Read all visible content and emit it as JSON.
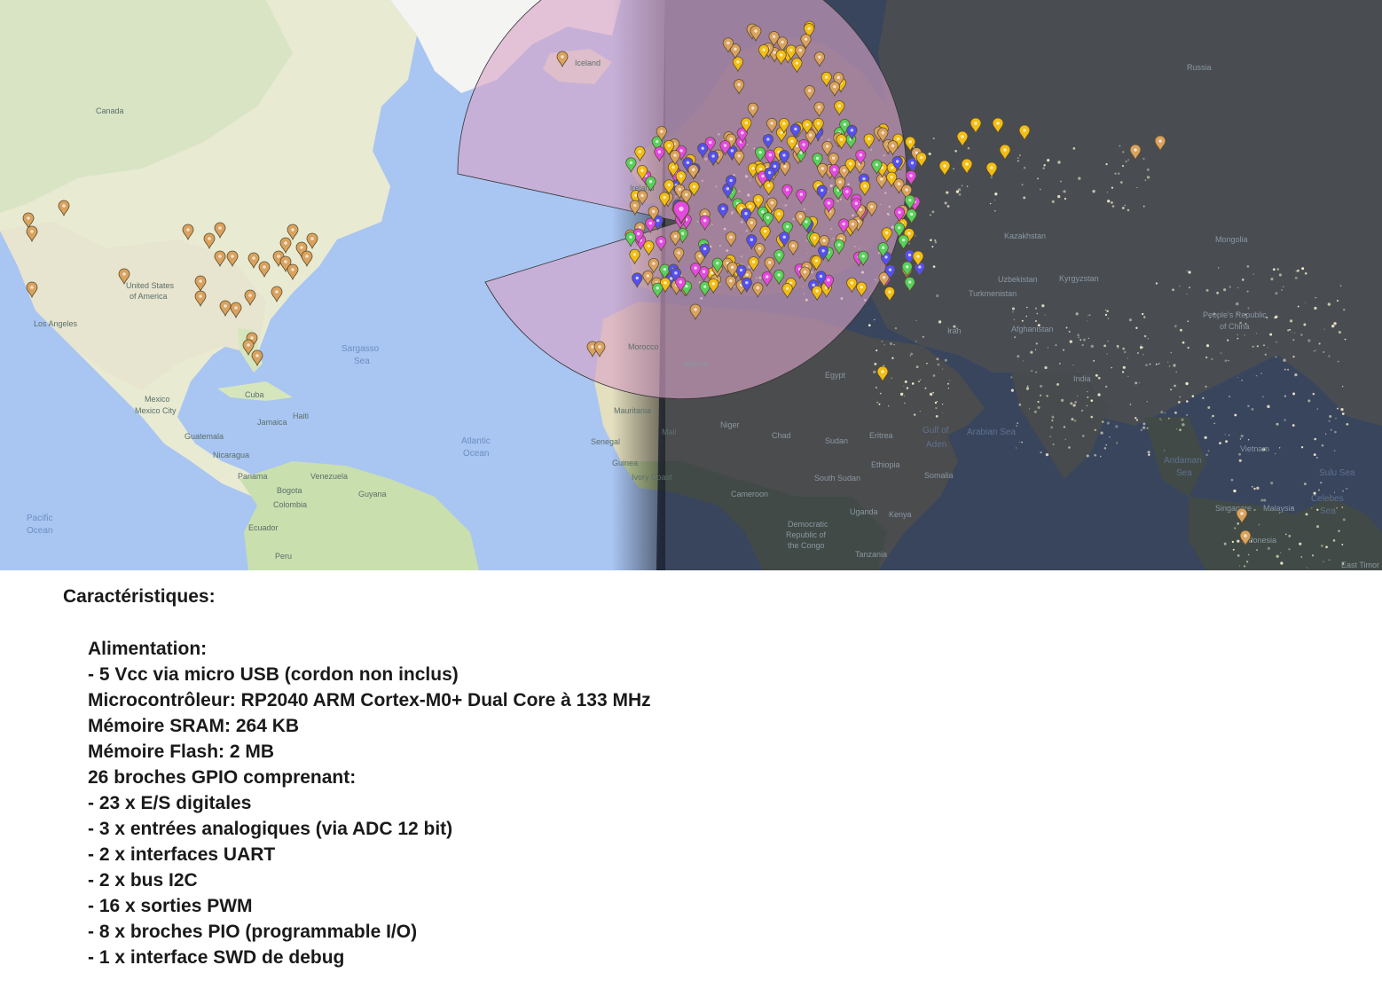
{
  "map": {
    "labels_light": [
      {
        "name": "canada",
        "text": "Canada"
      },
      {
        "name": "usa-1",
        "text": "United States"
      },
      {
        "name": "usa-2",
        "text": "of America"
      },
      {
        "name": "los-angeles",
        "text": "Los Angeles"
      },
      {
        "name": "mexico",
        "text": "Mexico"
      },
      {
        "name": "mexico-city",
        "text": "Mexico City"
      },
      {
        "name": "cuba",
        "text": "Cuba"
      },
      {
        "name": "haiti",
        "text": "Haiti"
      },
      {
        "name": "jamaica",
        "text": "Jamaica"
      },
      {
        "name": "guatemala",
        "text": "Guatemala"
      },
      {
        "name": "nicaragua",
        "text": "Nicaragua"
      },
      {
        "name": "panama",
        "text": "Panama"
      },
      {
        "name": "bogota",
        "text": "Bogota"
      },
      {
        "name": "colombia",
        "text": "Colombia"
      },
      {
        "name": "venezuela",
        "text": "Venezuela"
      },
      {
        "name": "guyana",
        "text": "Guyana"
      },
      {
        "name": "ecuador",
        "text": "Ecuador"
      },
      {
        "name": "peru",
        "text": "Peru"
      },
      {
        "name": "iceland",
        "text": "Iceland"
      },
      {
        "name": "ireland",
        "text": "Ireland"
      },
      {
        "name": "mauritania",
        "text": "Mauritania"
      },
      {
        "name": "senegal",
        "text": "Senegal"
      },
      {
        "name": "guinea",
        "text": "Guinea"
      },
      {
        "name": "ivory-coast",
        "text": "Ivory Coast"
      },
      {
        "name": "morocco",
        "text": "Morocco"
      },
      {
        "name": "mali",
        "text": "Mali"
      }
    ],
    "labels_ocean_light": [
      {
        "name": "sargasso-1",
        "text": "Sargasso"
      },
      {
        "name": "sargasso-2",
        "text": "Sea"
      },
      {
        "name": "atlantic-1",
        "text": "Atlantic"
      },
      {
        "name": "atlantic-2",
        "text": "Ocean"
      },
      {
        "name": "pacific-1",
        "text": "Pacific"
      },
      {
        "name": "pacific-2",
        "text": "Ocean"
      }
    ],
    "labels_dark": [
      {
        "name": "russia",
        "text": "Russia"
      },
      {
        "name": "kazakhstan",
        "text": "Kazakhstan"
      },
      {
        "name": "mongolia",
        "text": "Mongolia"
      },
      {
        "name": "uzbekistan",
        "text": "Uzbekistan"
      },
      {
        "name": "kyrgyzstan",
        "text": "Kyrgyzstan"
      },
      {
        "name": "turkmenistan",
        "text": "Turkmenistan"
      },
      {
        "name": "afghanistan",
        "text": "Afghanistan"
      },
      {
        "name": "iran",
        "text": "Iran"
      },
      {
        "name": "prc-1",
        "text": "People's Republic"
      },
      {
        "name": "prc-2",
        "text": "of China"
      },
      {
        "name": "egypt",
        "text": "Egypt"
      },
      {
        "name": "algeria",
        "text": "Algeria"
      },
      {
        "name": "niger",
        "text": "Niger"
      },
      {
        "name": "chad",
        "text": "Chad"
      },
      {
        "name": "sudan",
        "text": "Sudan"
      },
      {
        "name": "south-sudan",
        "text": "South Sudan"
      },
      {
        "name": "eritrea",
        "text": "Eritrea"
      },
      {
        "name": "ethiopia",
        "text": "Ethiopia"
      },
      {
        "name": "somalia",
        "text": "Somalia"
      },
      {
        "name": "cameroon",
        "text": "Cameroon"
      },
      {
        "name": "uganda",
        "text": "Uganda"
      },
      {
        "name": "kenya",
        "text": "Kenya"
      },
      {
        "name": "tanzania",
        "text": "Tanzania"
      },
      {
        "name": "congo-1",
        "text": "Democratic"
      },
      {
        "name": "congo-2",
        "text": "Republic of"
      },
      {
        "name": "congo-3",
        "text": "the Congo"
      },
      {
        "name": "india",
        "text": "India"
      },
      {
        "name": "vietnam",
        "text": "Vietnam"
      },
      {
        "name": "singapore",
        "text": "Singapore"
      },
      {
        "name": "malaysia",
        "text": "Malaysia"
      },
      {
        "name": "indonesia",
        "text": "Indonesia"
      },
      {
        "name": "east-timor",
        "text": "East Timor"
      }
    ],
    "labels_ocean_dark": [
      {
        "name": "arabian-sea",
        "text": "Arabian Sea"
      },
      {
        "name": "andaman-1",
        "text": "Andaman"
      },
      {
        "name": "andaman-2",
        "text": "Sea"
      },
      {
        "name": "sulu-1",
        "text": "Sulu Sea"
      },
      {
        "name": "celebes-1",
        "text": "Celebes"
      },
      {
        "name": "celebes-2",
        "text": "Sea"
      },
      {
        "name": "gulf-aden-1",
        "text": "Gulf of"
      },
      {
        "name": "gulf-aden-2",
        "text": "Aden"
      }
    ],
    "colors": {
      "ocean_light": "#a9c5f2",
      "ocean_dark": "#2b3a55",
      "land_light": "#e8ead2",
      "land_green": "#cfe0b8",
      "land_dark": "#3b3f3a",
      "land_dark_2": "#4a4637",
      "range_fill": "#d9a3c7",
      "marker_orange": "#d9a25e",
      "marker_yellow": "#f2bd14",
      "marker_green": "#58d05c",
      "marker_blue": "#5550f0",
      "marker_magenta": "#e34ae0"
    }
  },
  "specs": {
    "title": "Caractéristiques:",
    "items": [
      "Alimentation:",
      "- 5 Vcc via micro USB (cordon non inclus)",
      "Microcontrôleur: RP2040 ARM Cortex-M0+ Dual Core à 133 MHz",
      "Mémoire SRAM: 264 KB",
      "Mémoire Flash: 2 MB",
      "26 broches GPIO comprenant:",
      "- 23 x E/S digitales",
      "- 3 x entrées analogiques (via ADC 12 bit)",
      "- 2 x interfaces UART",
      "- 2 x bus I2C",
      "- 16 x sorties PWM",
      "- 8 x broches PIO (programmable I/O)",
      "- 1 x interface SWD de debug"
    ]
  }
}
